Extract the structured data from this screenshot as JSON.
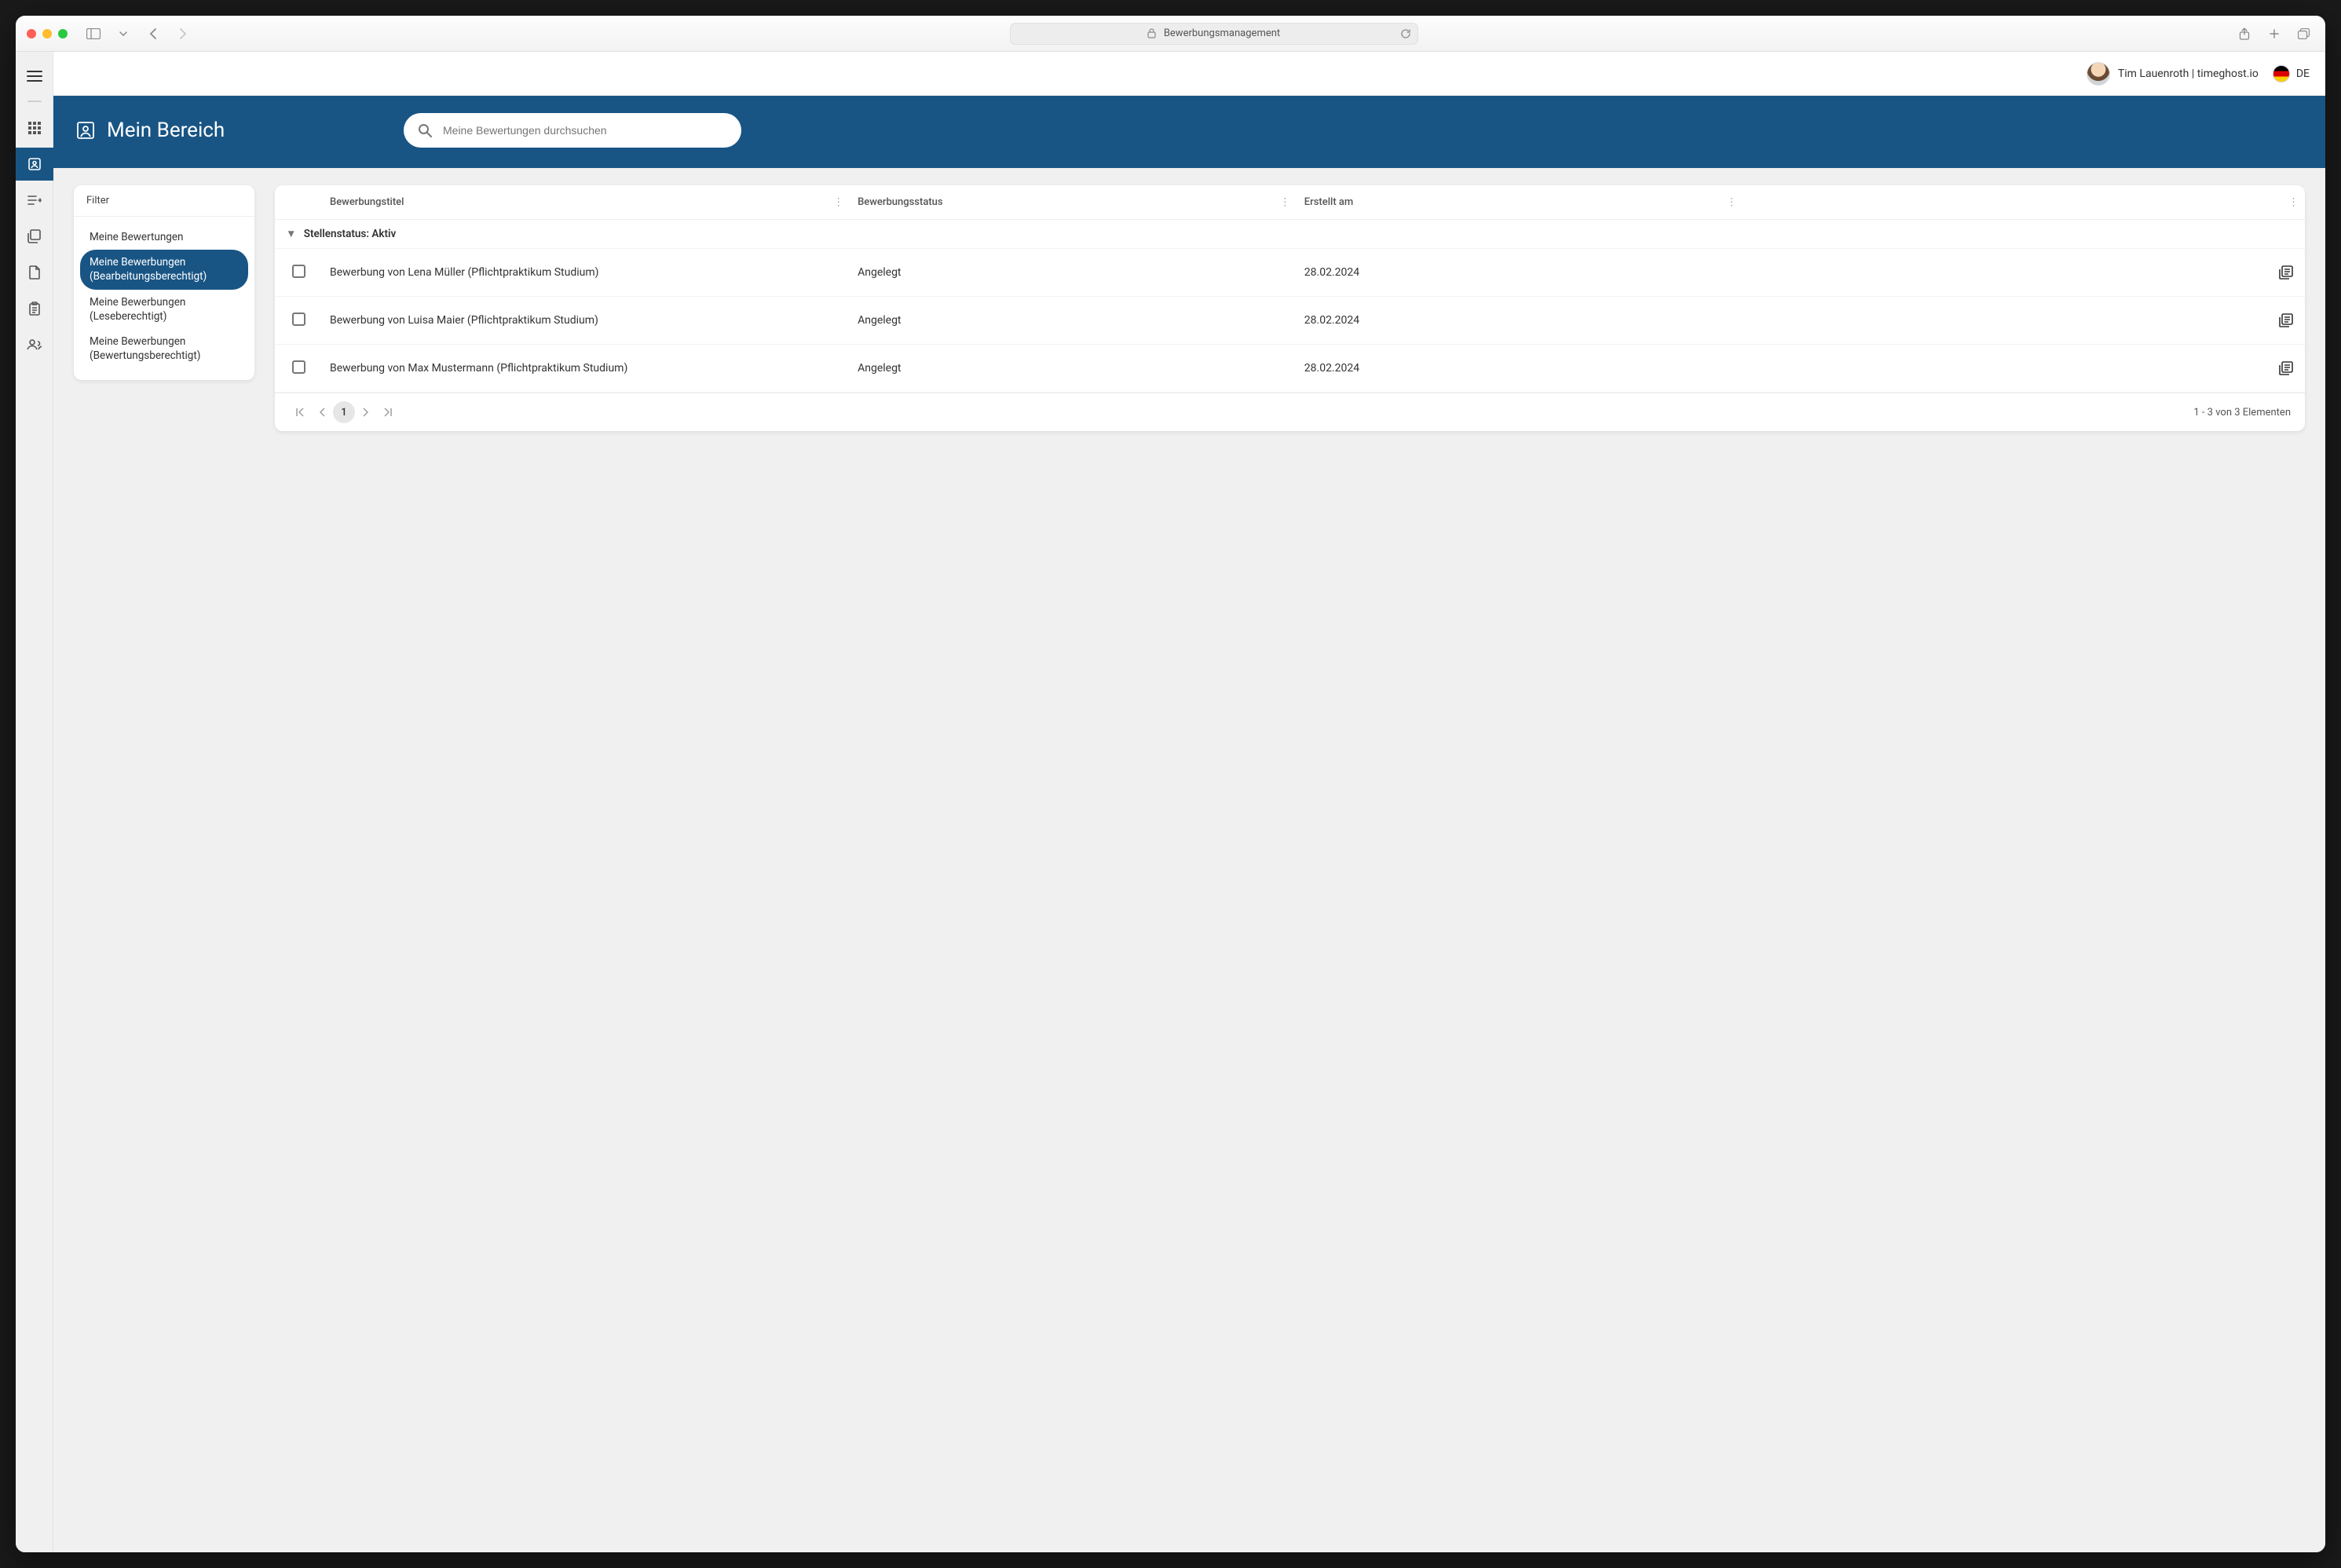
{
  "browser": {
    "address": "Bewerbungsmanagement"
  },
  "header": {
    "user": "Tim Lauenroth | timeghost.io",
    "language": "DE",
    "page_title": "Mein Bereich"
  },
  "search": {
    "placeholder": "Meine Bewertungen durchsuchen"
  },
  "filter": {
    "title": "Filter",
    "items": [
      {
        "label": "Meine Bewertungen",
        "active": false
      },
      {
        "label": "Meine Bewerbungen (Bearbeitungsberechtigt)",
        "active": true
      },
      {
        "label": "Meine Bewerbungen (Leseberechtigt)",
        "active": false
      },
      {
        "label": "Meine Bewerbungen (Bewertungsberechtigt)",
        "active": false
      }
    ]
  },
  "table": {
    "columns": [
      "Bewerbungstitel",
      "Bewerbungsstatus",
      "Erstellt am"
    ],
    "group_label": "Stellenstatus: Aktiv",
    "rows": [
      {
        "title": "Bewerbung von Lena Müller (Pflichtpraktikum Studium)",
        "status": "Angelegt",
        "created": "28.02.2024"
      },
      {
        "title": "Bewerbung von Luisa Maier (Pflichtpraktikum Studium)",
        "status": "Angelegt",
        "created": "28.02.2024"
      },
      {
        "title": "Bewerbung von Max Mustermann (Pflichtpraktikum Studium)",
        "status": "Angelegt",
        "created": "28.02.2024"
      }
    ]
  },
  "pager": {
    "current_page": "1",
    "summary": "1 - 3 von 3 Elementen"
  }
}
